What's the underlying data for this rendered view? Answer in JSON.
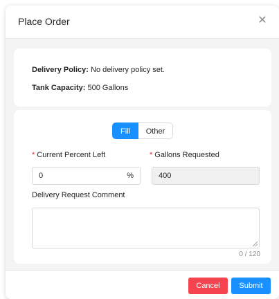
{
  "modal": {
    "title": "Place Order",
    "close_glyph": "✕",
    "close_icon": "close-icon"
  },
  "policy": {
    "delivery_policy_label": "Delivery Policy:",
    "delivery_policy_value": "No delivery policy set.",
    "tank_capacity_label": "Tank Capacity:",
    "tank_capacity_value": "500 Gallons"
  },
  "form": {
    "mode_options": [
      "Fill",
      "Other"
    ],
    "selected_mode": "Fill",
    "required_marker": "*",
    "current_percent_label": "Current Percent Left",
    "current_percent_value": "0",
    "current_percent_suffix": "%",
    "gallons_label": "Gallons Requested",
    "gallons_value": "400",
    "comment_label": "Delivery Request Comment",
    "comment_value": "",
    "comment_counter": "0 / 120"
  },
  "footer": {
    "cancel_label": "Cancel",
    "submit_label": "Submit"
  },
  "colors": {
    "primary": "#1890ff",
    "danger": "#f5444f",
    "required": "#f5222d"
  }
}
